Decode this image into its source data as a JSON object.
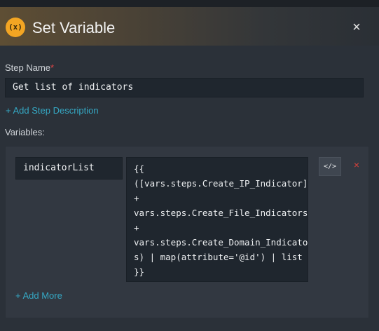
{
  "dialog": {
    "icon_text": "(x)",
    "title": "Set Variable",
    "close_glyph": "×"
  },
  "step_name": {
    "label": "Step Name",
    "required_mark": "*",
    "value": "Get list of indicators"
  },
  "add_description_label": "+ Add Step Description",
  "variables": {
    "label": "Variables:",
    "items": [
      {
        "name": "indicatorList",
        "value": "{{\n([vars.steps.Create_IP_Indicator]\n+\nvars.steps.Create_File_Indicators\n+\nvars.steps.Create_Domain_Indicator\ns) | map(attribute='@id') | list\n}}"
      }
    ],
    "code_toggle_glyph": "</>",
    "remove_glyph": "×",
    "add_more_label": "+ Add More"
  },
  "colors": {
    "accent": "#35a8c4",
    "badge": "#f3a523",
    "danger": "#d9403a"
  },
  "icons": [
    "variable-icon",
    "close-icon",
    "code-view-icon",
    "remove-icon"
  ]
}
